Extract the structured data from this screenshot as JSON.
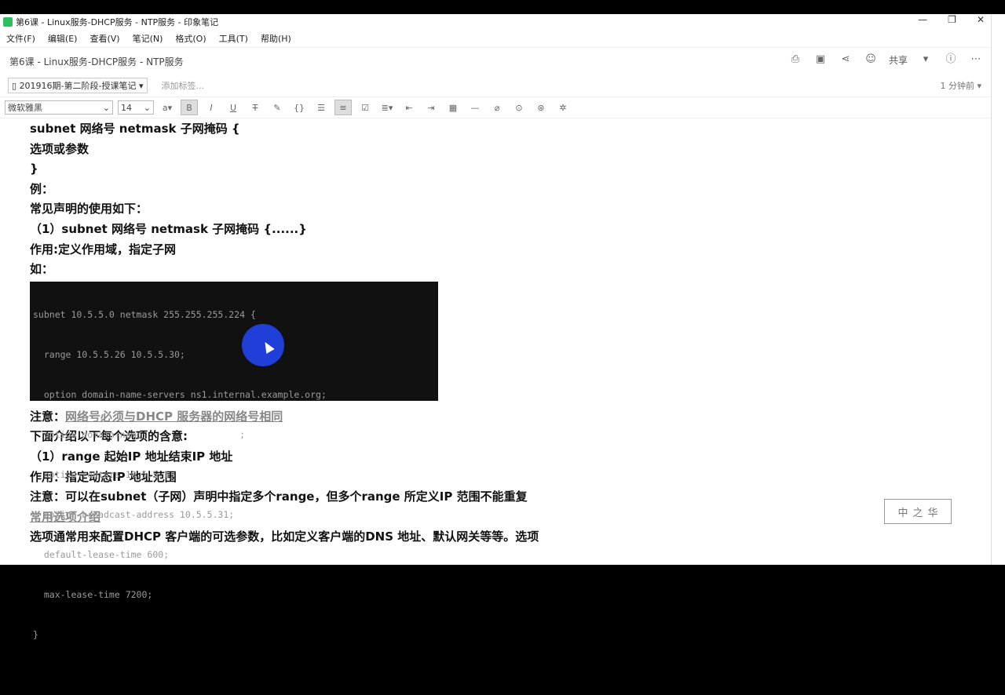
{
  "window": {
    "title": "第6课 - Linux服务-DHCP服务 - NTP服务 - 印象笔记",
    "controls": [
      "—",
      "❐",
      "✕"
    ]
  },
  "menu": [
    "文件(F)",
    "编辑(E)",
    "查看(V)",
    "笔记(N)",
    "格式(O)",
    "工具(T)",
    "帮助(H)"
  ],
  "note": {
    "title": "第6课 - Linux服务-DHCP服务 - NTP服务",
    "share_label": "共享",
    "notebook": "201916期-第二阶段-授课笔记",
    "add_tag": "添加标签...",
    "saved_time": "1 分钟前"
  },
  "format": {
    "font": "微软雅黑",
    "size": "14"
  },
  "content": {
    "l1": "subnet 网络号 netmask 子网掩码 {",
    "l2": "选项或参数",
    "l3": "}",
    "l4": "例：",
    "l5": "常见声明的使用如下：",
    "l6": "（1）subnet 网络号 netmask 子网掩码 {......}",
    "l7": "作用:定义作用域，指定子网",
    "l8": "如：",
    "terminal": [
      "subnet 10.5.5.0 netmask 255.255.255.224 {",
      "  range 10.5.5.26 10.5.5.30;",
      "  option domain-name-servers ns1.internal.example.org;",
      "  option domain-name                  ;",
      "  option routers 10.5.5.1;",
      "  option broadcast-address 10.5.5.31;",
      "  default-lease-time 600;",
      "  max-lease-time 7200;",
      "}"
    ],
    "note_label": "注意：",
    "note_text": "网络号必须与DHCP 服务器的网络号相同",
    "l10": "下面介绍以下每个选项的含意:",
    "l11": "（1）range 起始IP 地址结束IP 地址",
    "l12": "作用：指定动态IP 地址范围",
    "l13": "注意：可以在subnet（子网）声明中指定多个range，但多个range 所定义IP 范围不能重复",
    "l14": "常用选项介绍",
    "l15": "选项通常用来配置DHCP 客户端的可选参数，比如定义客户端的DNS 地址、默认网关等等。选项"
  },
  "stamp": [
    "中",
    "之",
    "华"
  ]
}
